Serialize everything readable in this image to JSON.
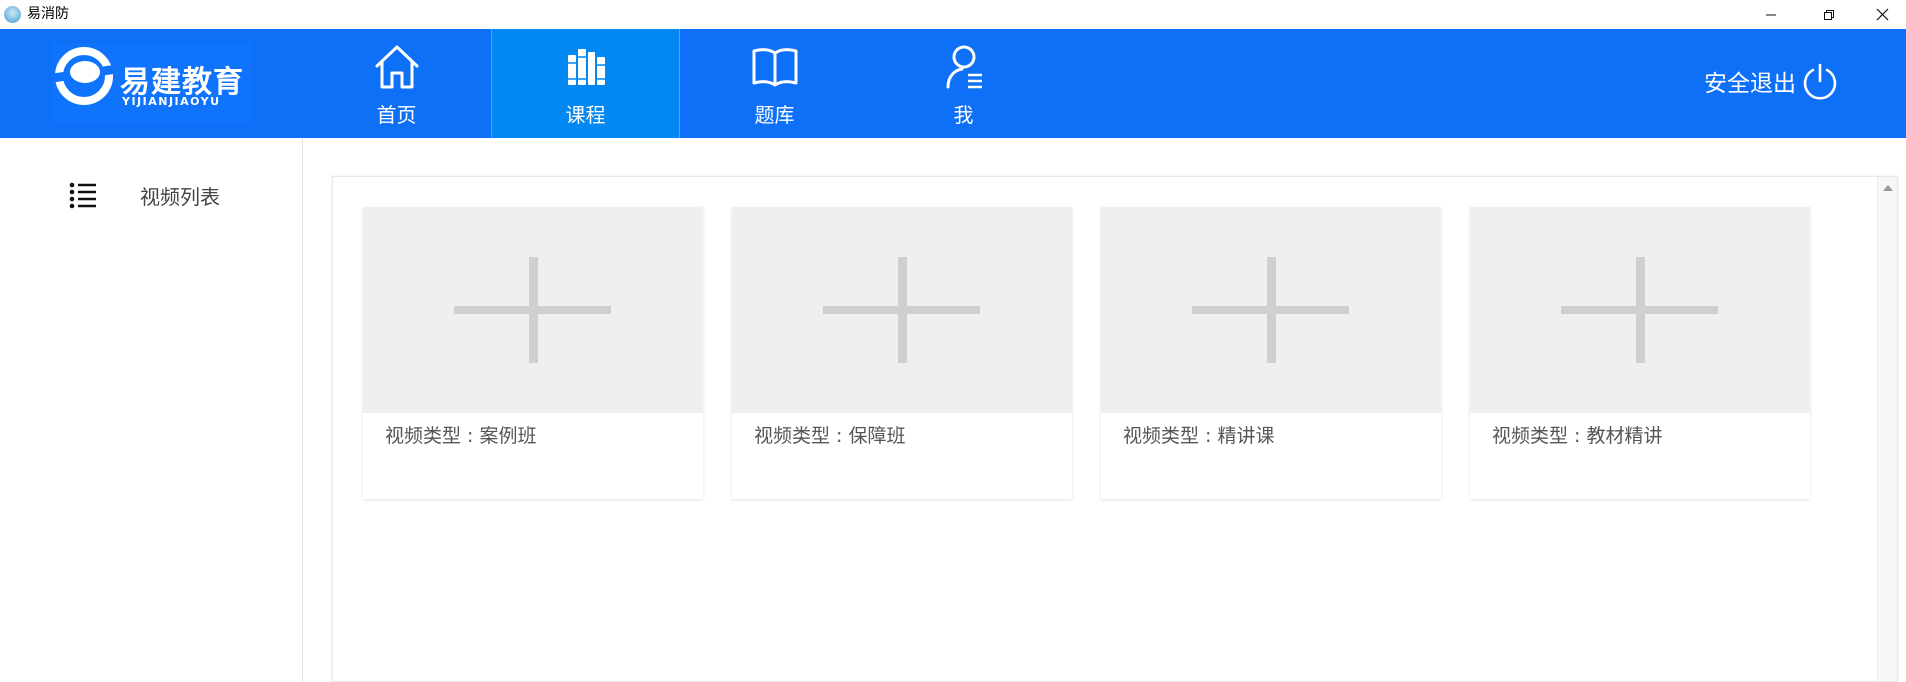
{
  "window": {
    "title": "易消防",
    "controls": {
      "minimize": "minimize-icon",
      "maximize": "restore-icon",
      "close": "close-icon"
    }
  },
  "header": {
    "logo": {
      "brand": "易建教育",
      "brand_en": "YIJIANJIAOYU"
    },
    "nav": [
      {
        "label": "首页",
        "icon": "home-icon",
        "active": false
      },
      {
        "label": "课程",
        "icon": "books-icon",
        "active": true
      },
      {
        "label": "题库",
        "icon": "open-book-icon",
        "active": false
      },
      {
        "label": "我",
        "icon": "user-icon",
        "active": false
      }
    ],
    "logout_label": "安全退出",
    "colors": {
      "header_bg": "#0e70f6",
      "active_tab_bg": "#0387f1"
    }
  },
  "sidebar": {
    "items": [
      {
        "label": "视频列表",
        "icon": "list-icon"
      }
    ]
  },
  "content": {
    "cards": [
      {
        "caption": "视频类型 : 案例班"
      },
      {
        "caption": "视频类型 : 保障班"
      },
      {
        "caption": "视频类型 : 精讲课"
      },
      {
        "caption": "视频类型 : 教材精讲"
      }
    ]
  }
}
